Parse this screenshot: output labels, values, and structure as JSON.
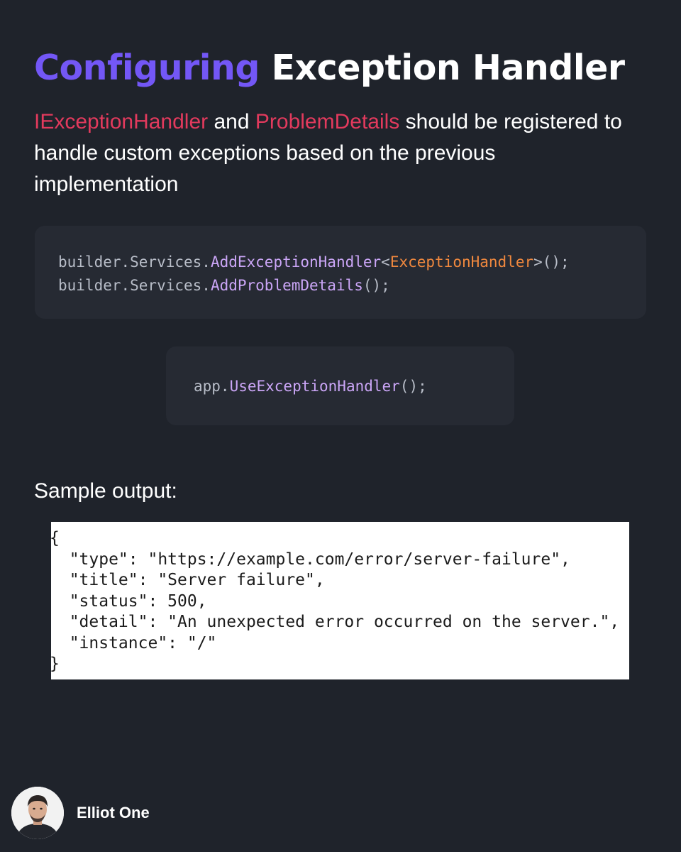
{
  "title": {
    "accent": "Configuring",
    "rest": "Exception Handler"
  },
  "intro": {
    "highlight_1": "IExceptionHandler",
    "text_1": " and ",
    "highlight_2": "ProblemDetails",
    "text_2": " should be registered to handle custom exceptions based on the previous implementation"
  },
  "code_block_1": {
    "line_1": {
      "prefix": "builder.Services.",
      "method": "AddExceptionHandler",
      "open": "<",
      "type": "ExceptionHandler",
      "close": ">();"
    },
    "line_2": {
      "prefix": "builder.Services.",
      "method": "AddProblemDetails",
      "close": "();"
    }
  },
  "code_block_2": {
    "prefix": "app.",
    "method": "UseExceptionHandler",
    "close": "();"
  },
  "sample_label": "Sample output:",
  "sample_output": {
    "open_brace": "{",
    "lines": [
      "  \"type\": \"https://example.com/error/server-failure\",",
      "  \"title\": \"Server failure\",",
      "  \"status\": 500,",
      "  \"detail\": \"An unexpected error occurred on the server.\",",
      "  \"instance\": \"/\""
    ],
    "close_brace": "}"
  },
  "author": {
    "name": "Elliot One"
  },
  "colors": {
    "background": "#1f232b",
    "code_background": "#262a33",
    "title_accent": "#7357f6",
    "highlight": "#e23a5d",
    "code_method": "#cba6f7",
    "code_type": "#f0883e",
    "code_plain": "#b8bdc8"
  }
}
